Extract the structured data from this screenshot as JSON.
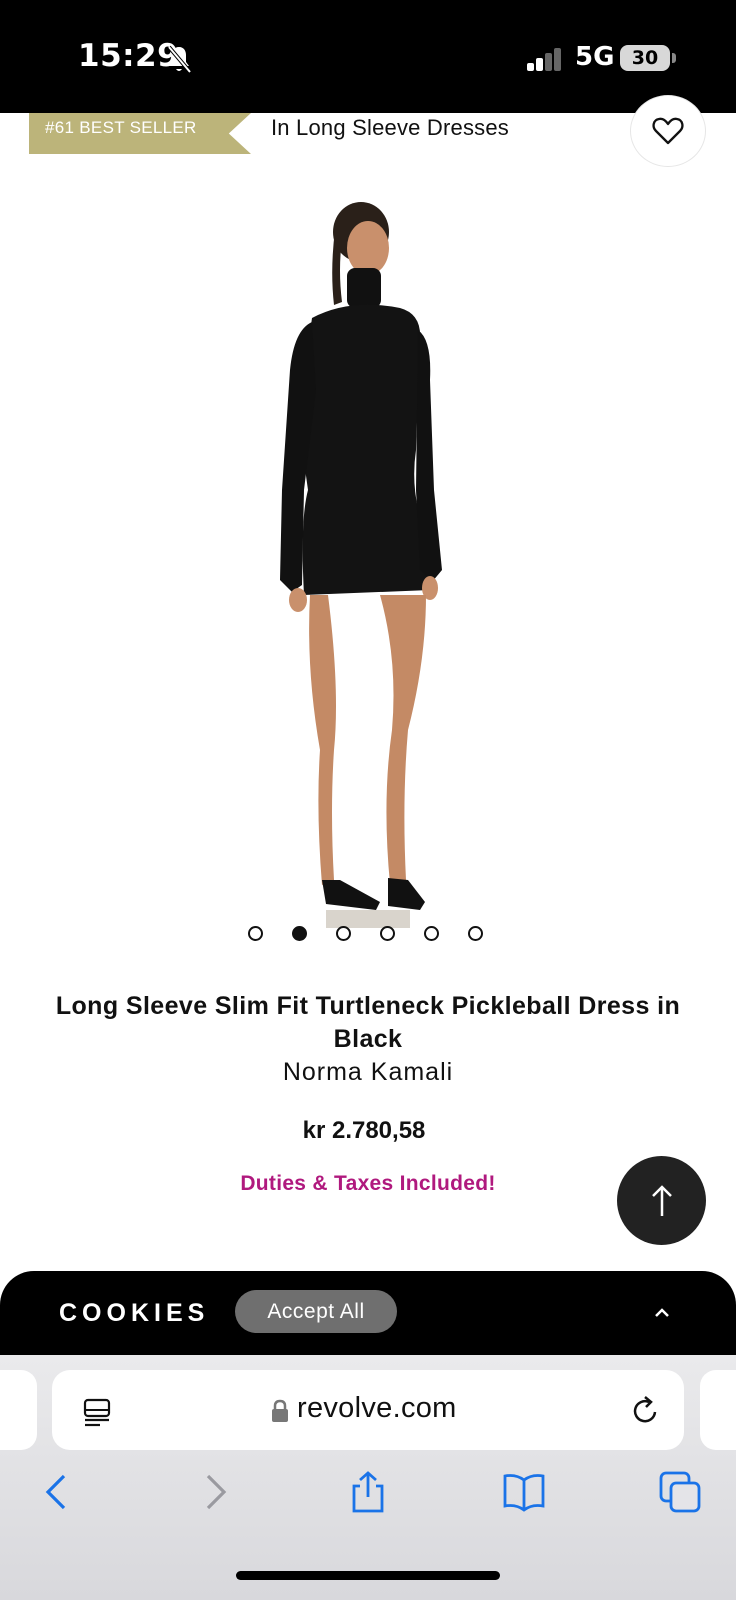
{
  "status_bar": {
    "time": "15:29",
    "network": "5G",
    "battery": "30",
    "icons": [
      "bell-off-icon",
      "signal-icon",
      "battery-icon"
    ]
  },
  "best_seller": {
    "badge": "#61 BEST SELLER",
    "category": "In Long Sleeve Dresses",
    "badge_color": "#bcb47a"
  },
  "product": {
    "title": "Long Sleeve Slim Fit Turtleneck Pickleball Dress in Black",
    "brand": "Norma Kamali",
    "price": "kr 2.780,58",
    "duties": "Duties & Taxes Included!",
    "duties_color": "#b0197e",
    "carousel": {
      "count": 6,
      "active_index": 1
    }
  },
  "cookies": {
    "label": "COOKIES",
    "accept_label": "Accept All"
  },
  "browser": {
    "url": "revolve.com",
    "toolbar": [
      "back-icon",
      "forward-icon",
      "share-icon",
      "bookmarks-icon",
      "tabs-icon"
    ],
    "accent": "#1a73e8"
  }
}
